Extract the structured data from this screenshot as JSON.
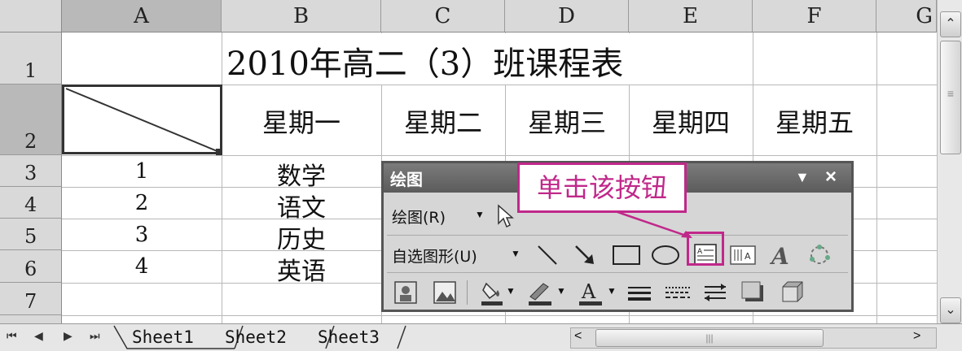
{
  "columns": [
    "A",
    "B",
    "C",
    "D",
    "E",
    "F",
    "G"
  ],
  "rows": [
    "1",
    "2",
    "3",
    "4",
    "5",
    "6",
    "7"
  ],
  "title": "2010年高二（3）班课程表",
  "weekdays": [
    "星期一",
    "星期二",
    "星期三",
    "星期四",
    "星期五"
  ],
  "periods": [
    "1",
    "2",
    "3",
    "4"
  ],
  "subjects_monday": [
    "数学",
    "语文",
    "历史",
    "英语"
  ],
  "sheet_tabs": [
    "Sheet1",
    "Sheet2",
    "Sheet3"
  ],
  "toolbar": {
    "title": "绘图",
    "menu_draw": "绘图(R)",
    "menu_autoshapes": "自选图形(U)",
    "close": "×",
    "dropdown": "▼"
  },
  "callout": "单击该按钮",
  "colors": {
    "accent": "#c0288a",
    "toolbar_title": "#6b6b6b",
    "header": "#d9d9d9"
  }
}
